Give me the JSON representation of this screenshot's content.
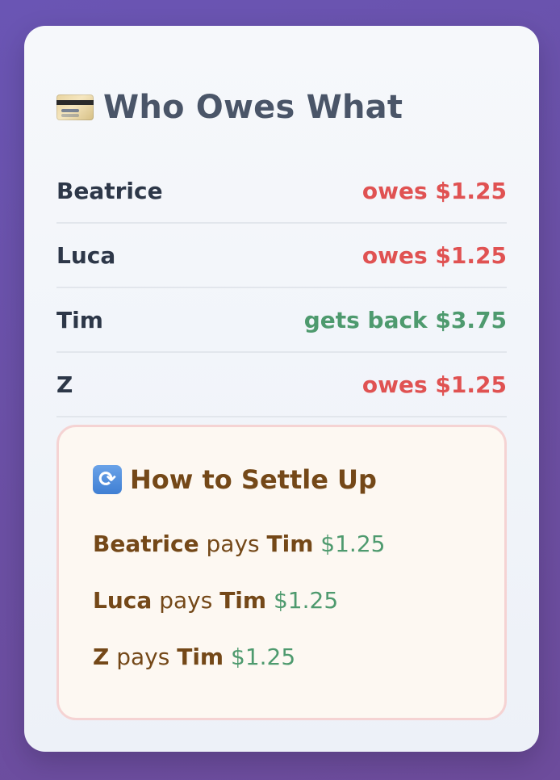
{
  "panel": {
    "title": "Who Owes What",
    "title_icon": "credit-card-icon"
  },
  "balances": [
    {
      "name": "Beatrice",
      "status": "owes $1.25",
      "type": "owes"
    },
    {
      "name": "Luca",
      "status": "owes $1.25",
      "type": "owes"
    },
    {
      "name": "Tim",
      "status": "gets back $3.75",
      "type": "gets"
    },
    {
      "name": "Z",
      "status": "owes $1.25",
      "type": "owes"
    }
  ],
  "settle": {
    "title": "How to Settle Up",
    "title_icon": "refresh-icon",
    "verb": "pays",
    "payments": [
      {
        "from": "Beatrice",
        "to": "Tim",
        "amount": "$1.25"
      },
      {
        "from": "Luca",
        "to": "Tim",
        "amount": "$1.25"
      },
      {
        "from": "Z",
        "to": "Tim",
        "amount": "$1.25"
      }
    ]
  },
  "colors": {
    "owes": "#e05252",
    "gets": "#4e9a6e",
    "settle_text": "#744818",
    "background_start": "#6a55b4"
  }
}
